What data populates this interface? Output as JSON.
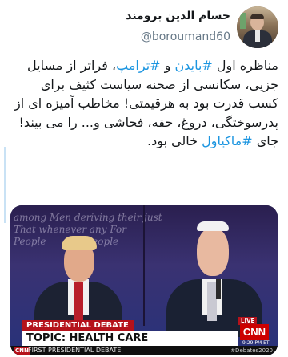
{
  "author": {
    "display_name": "حسام الدین برومند",
    "handle": "@boroumand60"
  },
  "tweet": {
    "segments": [
      {
        "text": "مناظره اول ",
        "hashtag": false
      },
      {
        "text": "#بایدن",
        "hashtag": true
      },
      {
        "text": " و ",
        "hashtag": false
      },
      {
        "text": "#ترامپ",
        "hashtag": true
      },
      {
        "text": "، فراتر از مسایل جزیی، سکانسی از صحنه سیاست کثیف برای کسب قدرت بود به هرقیمتی! مخاطب آمیزه ای از پدرسوختگی، دروغ، حقه، فحاشی و... را می بیند! جای ",
        "hashtag": false
      },
      {
        "text": "#ماکیاول",
        "hashtag": true
      },
      {
        "text": " خالی بود.",
        "hashtag": false
      }
    ]
  },
  "media": {
    "backdrop_text": "among Men deriving their just\nThat whenever any For\nPeople       the People",
    "chyron_label": "PRESIDENTIAL DEBATE",
    "chyron_topic": "TOPIC: HEALTH CARE",
    "network_small": "CNN",
    "bottom_caption": "FIRST PRESIDENTIAL DEBATE",
    "hashtag_tag": "#Debates2020",
    "live_label": "LIVE",
    "network_logo": "CNN",
    "clock": "9:29 PM ET"
  },
  "colors": {
    "hashtag": "#1b95e0",
    "chyron_red": "#b5121b",
    "cnn_red": "#cc0000"
  }
}
